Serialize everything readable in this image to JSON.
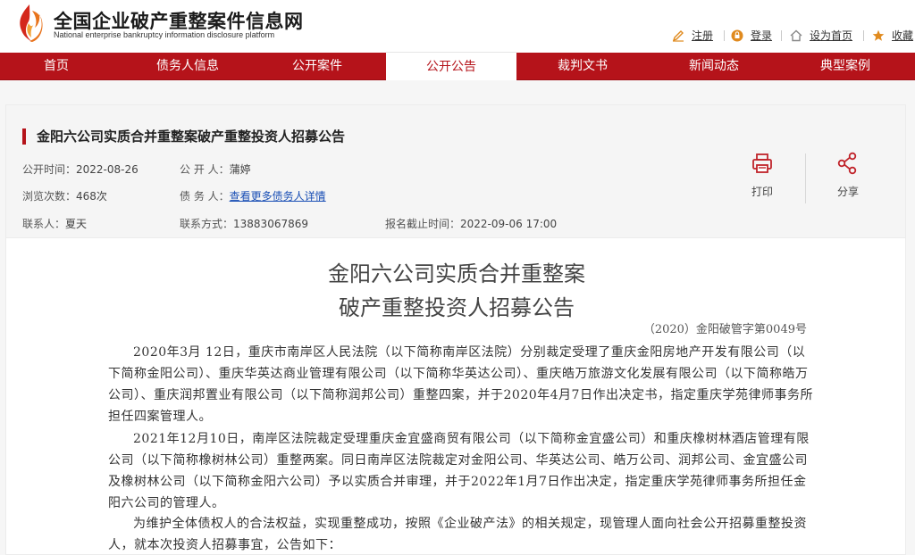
{
  "header": {
    "site_title": "全国企业破产重整案件信息网",
    "site_subtitle": "National enterprise bankruptcy  information disclosure platform",
    "links": [
      {
        "label": "注册",
        "icon": "register-icon"
      },
      {
        "label": "登录",
        "icon": "login-icon"
      },
      {
        "label": "设为首页",
        "icon": "home-icon"
      },
      {
        "label": "收藏",
        "icon": "star-icon"
      }
    ]
  },
  "nav": {
    "items": [
      "首页",
      "债务人信息",
      "公开案件",
      "公开公告",
      "裁判文书",
      "新闻动态",
      "典型案例"
    ],
    "active_index": 3
  },
  "notice": {
    "title": "金阳六公司实质合并重整案破产重整投资人招募公告",
    "publish_time_label": "公开时间：",
    "publish_time": "2022-08-26",
    "publisher_label": "公 开 人：",
    "publisher": "蒲婷",
    "views_label": "浏览次数：",
    "views": "468次",
    "debtor_label": "债 务 人：",
    "debtor_link": "查看更多债务人详情",
    "contact_label": "联系人：",
    "contact": "夏天",
    "phone_label": "联系方式：",
    "phone": "13883067869",
    "deadline_label": "报名截止时间：",
    "deadline": "2022-09-06 17:00",
    "print_label": "打印",
    "share_label": "分享"
  },
  "article": {
    "title_line1": "金阳六公司实质合并重整案",
    "title_line2": "破产重整投资人招募公告",
    "doc_no": "（2020）金阳破管字第0049号",
    "paragraphs": [
      "2020年3月 12日，重庆市南岸区人民法院（以下简称南岸区法院）分别裁定受理了重庆金阳房地产开发有限公司（以下简称金阳公司）、重庆华英达商业管理有限公司（以下简称华英达公司）、重庆皓万旅游文化发展有限公司（以下简称皓万公司）、重庆润邦置业有限公司（以下简称润邦公司）重整四案，并于2020年4月7日作出决定书，指定重庆学苑律师事务所担任四案管理人。",
      "2021年12月10日，南岸区法院裁定受理重庆金宜盛商贸有限公司（以下简称金宜盛公司）和重庆橡树林酒店管理有限公司（以下简称橡树林公司）重整两案。同日南岸区法院裁定对金阳公司、华英达公司、皓万公司、润邦公司、金宜盛公司及橡树林公司（以下简称金阳六公司）予以实质合并审理，并于2022年1月7日作出决定，指定重庆学苑律师事务所担任金阳六公司的管理人。",
      "为维护全体债权人的合法权益，实现重整成功，按照《企业破产法》的相关规定，现管理人面向社会公开招募重整投资人，就本次投资人招募事宜，公告如下："
    ]
  },
  "colors": {
    "brand_red": "#b5131a",
    "link_blue": "#1a4fb5",
    "logo_orange": "#e8731c"
  }
}
